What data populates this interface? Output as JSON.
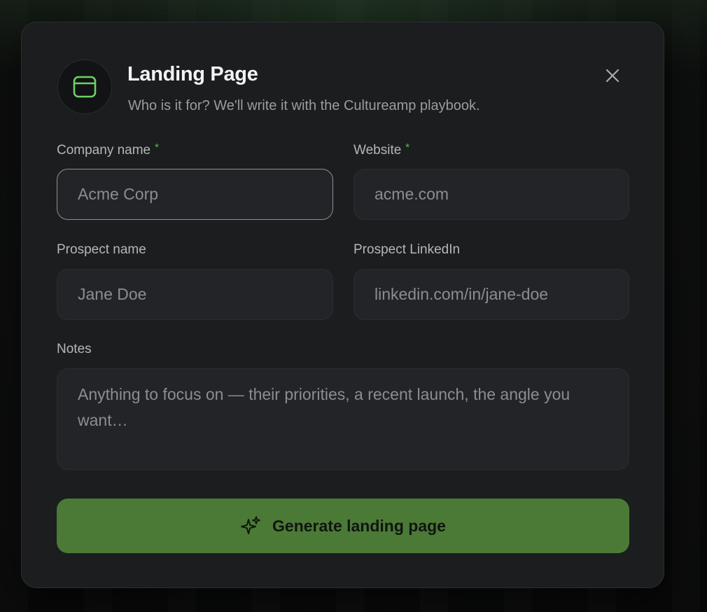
{
  "modal": {
    "title": "Landing Page",
    "subtitle": "Who is it for? We'll write it with the Cultureamp playbook.",
    "header_icon": "browser-window-icon",
    "close_icon": "close-icon"
  },
  "form": {
    "company": {
      "label": "Company name",
      "required_mark": "*",
      "placeholder": "Acme Corp",
      "value": ""
    },
    "website": {
      "label": "Website",
      "required_mark": "*",
      "placeholder": "acme.com",
      "value": ""
    },
    "prospect_name": {
      "label": "Prospect name",
      "placeholder": "Jane Doe",
      "value": ""
    },
    "prospect_linkedin": {
      "label": "Prospect LinkedIn",
      "placeholder": "linkedin.com/in/jane-doe",
      "value": ""
    },
    "notes": {
      "label": "Notes",
      "placeholder": "Anything to focus on — their priorities, a recent launch, the angle you want…",
      "value": ""
    }
  },
  "actions": {
    "generate_label": "Generate landing page",
    "generate_icon": "sparkles-icon"
  },
  "colors": {
    "accent": "#5fb957",
    "button_bg": "#4b7a37",
    "modal_bg": "#1c1d1f"
  }
}
